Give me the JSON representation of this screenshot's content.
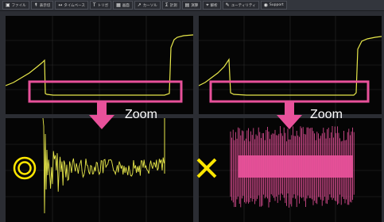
{
  "toolbar": {
    "items": [
      {
        "label": "ファイル",
        "icon": "folder-icon"
      },
      {
        "label": "表示切",
        "icon": "display-icon"
      },
      {
        "label": "タイムベース",
        "icon": "timebase-icon"
      },
      {
        "label": "トリガ",
        "icon": "trigger-icon"
      },
      {
        "label": "画面",
        "icon": "screen-icon"
      },
      {
        "label": "カーソル",
        "icon": "cursor-icon"
      },
      {
        "label": "計測",
        "icon": "measure-icon"
      },
      {
        "label": "演算",
        "icon": "math-icon"
      },
      {
        "label": "解析",
        "icon": "analysis-icon"
      },
      {
        "label": "ユーティリティ",
        "icon": "utility-icon"
      },
      {
        "label": "Support",
        "icon": "support-icon"
      }
    ]
  },
  "annotations": {
    "zoom_left": "Zoom",
    "zoom_right": "Zoom",
    "good_mark": "circle-ok-icon",
    "bad_mark": "cross-ng-icon"
  },
  "colors": {
    "trace": "#e8e84a",
    "highlight": "#e8519a",
    "screen_bg": "#050505",
    "grid": "#2e2e2e",
    "good": "#ffe600",
    "bad": "#ffe600"
  }
}
